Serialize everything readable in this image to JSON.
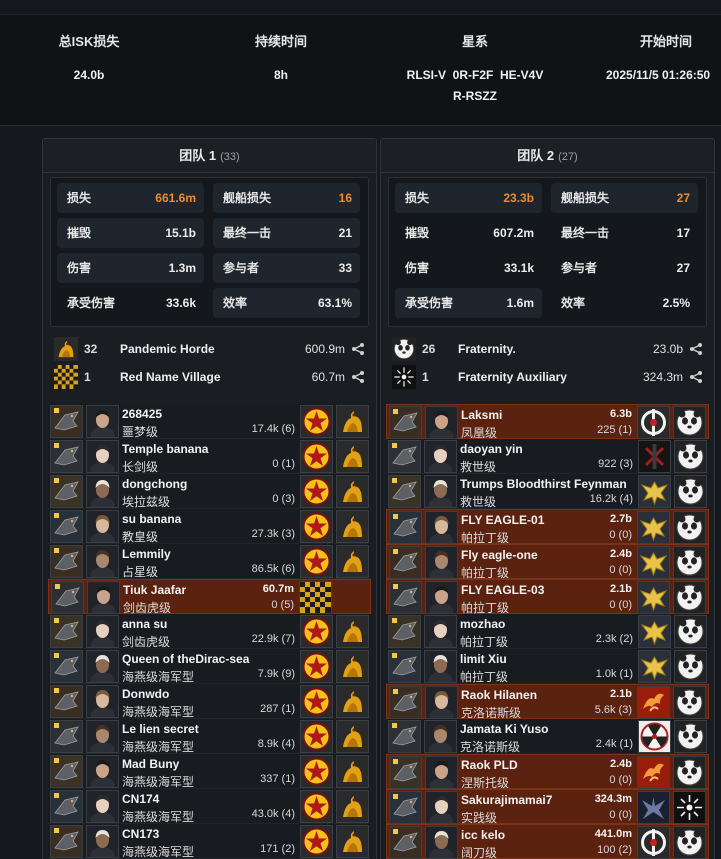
{
  "summary": {
    "isk_label": "总ISK损失",
    "isk_value": "24.0b",
    "duration_label": "持续时间",
    "duration_value": "8h",
    "systems_label": "星系",
    "systems_line1": "RLSI-V  0R-F2F  HE-V4V",
    "systems_line2": "R-RSZZ",
    "start_label": "开始时间",
    "start_value": "2025/11/5 01:26:50"
  },
  "teams": [
    {
      "name": "团队 1",
      "count": "(33)",
      "stats": [
        {
          "k": "损失",
          "v": "661.6m",
          "orange": true,
          "boxed": true
        },
        {
          "k": "舰船损失",
          "v": "16",
          "orange": true,
          "boxed": true
        },
        {
          "k": "摧毁",
          "v": "15.1b",
          "orange": false,
          "boxed": true
        },
        {
          "k": "最终一击",
          "v": "21",
          "orange": false,
          "boxed": true
        },
        {
          "k": "伤害",
          "v": "1.3m",
          "orange": false,
          "boxed": true
        },
        {
          "k": "参与者",
          "v": "33",
          "orange": false,
          "boxed": true
        },
        {
          "k": "承受伤害",
          "v": "33.6k",
          "orange": false,
          "boxed": false
        },
        {
          "k": "效率",
          "v": "63.1%",
          "orange": false,
          "boxed": true
        }
      ],
      "corps": [
        {
          "logo": "pandemic-horde-logo",
          "count": "32",
          "name": "Pandemic Horde",
          "isk": "600.9m"
        },
        {
          "logo": "red-name-village-logo",
          "count": "1",
          "name": "Red Name Village",
          "isk": "60.7m"
        }
      ],
      "pilots": [
        {
          "name": "268425",
          "ship": "噩梦级",
          "isk": "",
          "dmg": "17.4k (6)",
          "hl": false,
          "logo1": "star",
          "logo2": "horde"
        },
        {
          "name": "Temple banana",
          "ship": "长剑级",
          "isk": "",
          "dmg": "0 (1)",
          "hl": false,
          "logo1": "star",
          "logo2": "horde"
        },
        {
          "name": "dongchong",
          "ship": "埃拉兹级",
          "isk": "",
          "dmg": "0 (3)",
          "hl": false,
          "logo1": "star",
          "logo2": "horde"
        },
        {
          "name": "su banana",
          "ship": "教皇级",
          "isk": "",
          "dmg": "27.3k (3)",
          "hl": false,
          "logo1": "star",
          "logo2": "horde"
        },
        {
          "name": "Lemmily",
          "ship": "占星级",
          "isk": "",
          "dmg": "86.5k (6)",
          "hl": false,
          "logo1": "star",
          "logo2": "horde"
        },
        {
          "name": "Tiuk Jaafar",
          "ship": "剑齿虎级",
          "isk": "60.7m",
          "dmg": "0 (5)",
          "hl": true,
          "logo1": "checker",
          "logo2": "none"
        },
        {
          "name": "anna su",
          "ship": "剑齿虎级",
          "isk": "",
          "dmg": "22.9k (7)",
          "hl": false,
          "logo1": "star",
          "logo2": "horde"
        },
        {
          "name": "Queen of theDirac-sea",
          "ship": "海燕级海军型",
          "isk": "",
          "dmg": "7.9k (9)",
          "hl": false,
          "logo1": "star",
          "logo2": "horde"
        },
        {
          "name": "Donwdo",
          "ship": "海燕级海军型",
          "isk": "",
          "dmg": "287 (1)",
          "hl": false,
          "logo1": "star",
          "logo2": "horde"
        },
        {
          "name": "Le lien secret",
          "ship": "海燕级海军型",
          "isk": "",
          "dmg": "8.9k (4)",
          "hl": false,
          "logo1": "star",
          "logo2": "horde"
        },
        {
          "name": "Mad Buny",
          "ship": "海燕级海军型",
          "isk": "",
          "dmg": "337 (1)",
          "hl": false,
          "logo1": "star",
          "logo2": "horde"
        },
        {
          "name": "CN174",
          "ship": "海燕级海军型",
          "isk": "",
          "dmg": "43.0k (4)",
          "hl": false,
          "logo1": "star",
          "logo2": "horde"
        },
        {
          "name": "CN173",
          "ship": "海燕级海军型",
          "isk": "",
          "dmg": "171 (2)",
          "hl": false,
          "logo1": "star",
          "logo2": "horde"
        }
      ]
    },
    {
      "name": "团队 2",
      "count": "(27)",
      "stats": [
        {
          "k": "损失",
          "v": "23.3b",
          "orange": true,
          "boxed": true
        },
        {
          "k": "舰船损失",
          "v": "27",
          "orange": true,
          "boxed": true
        },
        {
          "k": "摧毁",
          "v": "607.2m",
          "orange": false,
          "boxed": false
        },
        {
          "k": "最终一击",
          "v": "17",
          "orange": false,
          "boxed": false
        },
        {
          "k": "伤害",
          "v": "33.1k",
          "orange": false,
          "boxed": false
        },
        {
          "k": "参与者",
          "v": "27",
          "orange": false,
          "boxed": false
        },
        {
          "k": "承受伤害",
          "v": "1.6m",
          "orange": false,
          "boxed": true
        },
        {
          "k": "效率",
          "v": "2.5%",
          "orange": false,
          "boxed": false
        }
      ],
      "corps": [
        {
          "logo": "fraternity-logo",
          "count": "26",
          "name": "Fraternity.",
          "isk": "23.0b"
        },
        {
          "logo": "fraternity-auxiliary-logo",
          "count": "1",
          "name": "Fraternity Auxiliary",
          "isk": "324.3m"
        }
      ],
      "pilots": [
        {
          "name": "Laksmi",
          "ship": "凤凰级",
          "isk": "6.3b",
          "dmg": "225 (1)",
          "hl": true,
          "logo1": "ring",
          "logo2": "panda"
        },
        {
          "name": "daoyan yin",
          "ship": "救世级",
          "isk": "",
          "dmg": "922 (3)",
          "hl": false,
          "logo1": "redx",
          "logo2": "panda"
        },
        {
          "name": "Trumps Bloodthirst Feynman",
          "ship": "救世级",
          "isk": "",
          "dmg": "16.2k (4)",
          "hl": false,
          "logo1": "eagle",
          "logo2": "panda"
        },
        {
          "name": "FLY EAGLE-01",
          "ship": "帕拉丁级",
          "isk": "2.7b",
          "dmg": "0 (0)",
          "hl": true,
          "logo1": "eagle",
          "logo2": "panda"
        },
        {
          "name": "Fly eagle-one",
          "ship": "帕拉丁级",
          "isk": "2.4b",
          "dmg": "0 (0)",
          "hl": true,
          "logo1": "eagle",
          "logo2": "panda"
        },
        {
          "name": "FLY EAGLE-03",
          "ship": "帕拉丁级",
          "isk": "2.1b",
          "dmg": "0 (0)",
          "hl": true,
          "logo1": "eagle",
          "logo2": "panda"
        },
        {
          "name": "mozhao",
          "ship": "帕拉丁级",
          "isk": "",
          "dmg": "2.3k (2)",
          "hl": false,
          "logo1": "eagle",
          "logo2": "panda"
        },
        {
          "name": "limit Xiu",
          "ship": "帕拉丁级",
          "isk": "",
          "dmg": "1.0k (1)",
          "hl": false,
          "logo1": "eagle",
          "logo2": "panda"
        },
        {
          "name": "Raok Hilanen",
          "ship": "克洛诺斯级",
          "isk": "2.1b",
          "dmg": "5.6k (3)",
          "hl": true,
          "logo1": "phoenix",
          "logo2": "panda"
        },
        {
          "name": "Jamata Ki Yuso",
          "ship": "克洛诺斯级",
          "isk": "",
          "dmg": "2.4k (1)",
          "hl": false,
          "logo1": "radiation",
          "logo2": "panda"
        },
        {
          "name": "Raok PLD",
          "ship": "涅斯托级",
          "isk": "2.4b",
          "dmg": "0 (0)",
          "hl": true,
          "logo1": "phoenix",
          "logo2": "panda"
        },
        {
          "name": "Sakurajimamai7",
          "ship": "实践级",
          "isk": "324.3m",
          "dmg": "0 (0)",
          "hl": true,
          "logo1": "wings",
          "logo2": "sun"
        },
        {
          "name": "icc kelo",
          "ship": "阔刀级",
          "isk": "441.0m",
          "dmg": "100 (2)",
          "hl": true,
          "logo1": "ring",
          "logo2": "panda"
        }
      ]
    }
  ],
  "colors": {
    "accent_orange": "#f08a2c",
    "loss_row_bg": "#5c2210",
    "panel_bg": "#1a1e23"
  }
}
